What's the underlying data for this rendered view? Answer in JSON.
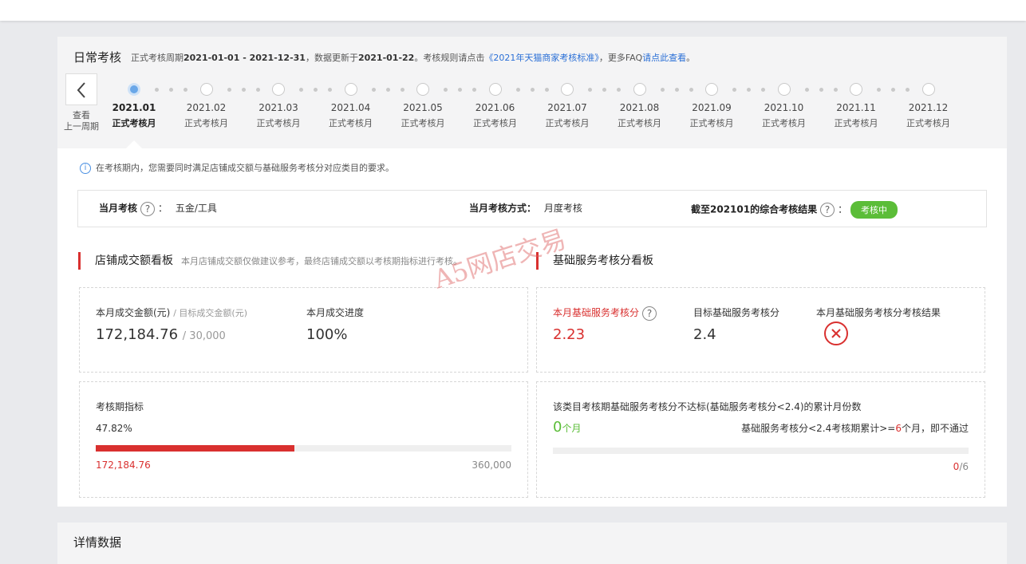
{
  "header": {
    "title": "日常考核",
    "period_prefix": "正式考核周期",
    "period": "2021-01-01 - 2021-12-31",
    "update_prefix": "，数据更新于",
    "update_date": "2021-01-22",
    "rule_prefix": "。考核规则请点击",
    "rule_link": "《2021年天猫商家考核标准》",
    "faq_prefix": "，更多FAQ",
    "faq_link": "请点此查看",
    "faq_suffix": "。"
  },
  "prev": {
    "line1": "查看",
    "line2": "上一周期"
  },
  "months": [
    {
      "date": "2021.01",
      "label": "正式考核月"
    },
    {
      "date": "2021.02",
      "label": "正式考核月"
    },
    {
      "date": "2021.03",
      "label": "正式考核月"
    },
    {
      "date": "2021.04",
      "label": "正式考核月"
    },
    {
      "date": "2021.05",
      "label": "正式考核月"
    },
    {
      "date": "2021.06",
      "label": "正式考核月"
    },
    {
      "date": "2021.07",
      "label": "正式考核月"
    },
    {
      "date": "2021.08",
      "label": "正式考核月"
    },
    {
      "date": "2021.09",
      "label": "正式考核月"
    },
    {
      "date": "2021.10",
      "label": "正式考核月"
    },
    {
      "date": "2021.11",
      "label": "正式考核月"
    },
    {
      "date": "2021.12",
      "label": "正式考核月"
    }
  ],
  "notice": "在考核期内，您需要同时满足店铺成交额与基础服务考核分对应类目的要求。",
  "summary": {
    "month_label": "当月考核",
    "colon": "：",
    "category": "五金/工具",
    "method_label": "当月考核方式：",
    "method": "月度考核",
    "result_label": "截至202101的综合考核结果",
    "result_badge": "考核中"
  },
  "sales": {
    "title": "店铺成交额看板",
    "note": "本月店铺成交额仅做建议参考，最终店铺成交额以考核期指标进行考核。",
    "amount_label": "本月成交金额(元)",
    "target_label": "/ 目标成交金额(元)",
    "amount": "172,184.76",
    "target": "/ 30,000",
    "progress_label": "本月成交进度",
    "progress": "100%",
    "period_label": "考核期指标",
    "period_percent": "47.82%",
    "period_fraction": 0.4782,
    "period_current": "172,184.76",
    "period_target": "360,000"
  },
  "service": {
    "title": "基础服务考核分看板",
    "score_label": "本月基础服务考核分",
    "score": "2.23",
    "target_label": "目标基础服务考核分",
    "target": "2.4",
    "result_label": "本月基础服务考核分考核结果",
    "fail_text": "该类目考核期基础服务考核分不达标(基础服务考核分<2.4)的累计月份数",
    "months_count": "0",
    "months_unit": "个月",
    "rule_prefix": "基础服务考核分<2.4考核期累计>=",
    "rule_num": "6",
    "rule_suffix": "个月，即不通过",
    "progress_current": "0",
    "progress_total": "/6",
    "progress_fraction": 0
  },
  "watermark": "A5网店交易",
  "details": {
    "title": "详情数据"
  },
  "colors": {
    "accent_red": "#d9302f",
    "green": "#5bbd38",
    "link_blue": "#2a6fd6"
  }
}
